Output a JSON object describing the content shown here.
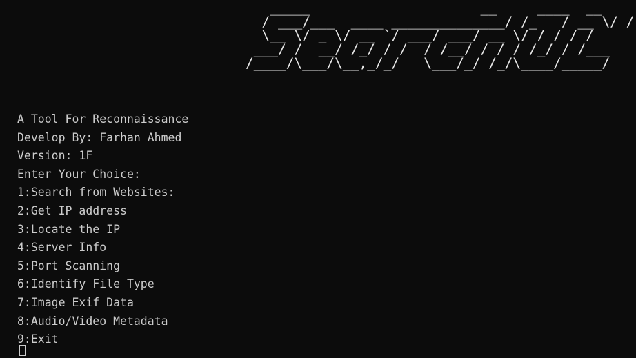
{
  "terminal": {
    "banner_ascii": "   _____                     __     ____  __\n  / ___/___  ____ ______________/ /_   / __ \\/ /\n  \\__ \\/ _ \\/ __ `/ ___/ ___/ __ \\/ / / / /\n ___/ /  __/ /_/ / /  / /__/ / / / /_/ / /___\n/____/\\___/\\__,_/_/   \\___/_/ /_/\\____/_____/",
    "lines": [
      "A Tool For Reconnaissance",
      "Develop By: Farhan Ahmed",
      "Version: 1F",
      "Enter Your Choice:",
      "1:Search from Websites:",
      "2:Get IP address",
      "3:Locate the IP",
      "4:Server Info",
      "5:Port Scanning",
      "6:Identify File Type",
      "7:Image Exif Data",
      "8:Audio/Video Metadata",
      "9:Exit"
    ],
    "colors": {
      "background": "#0c0c0c",
      "text": "#cccccc",
      "banner": "#e8e8e8"
    }
  }
}
